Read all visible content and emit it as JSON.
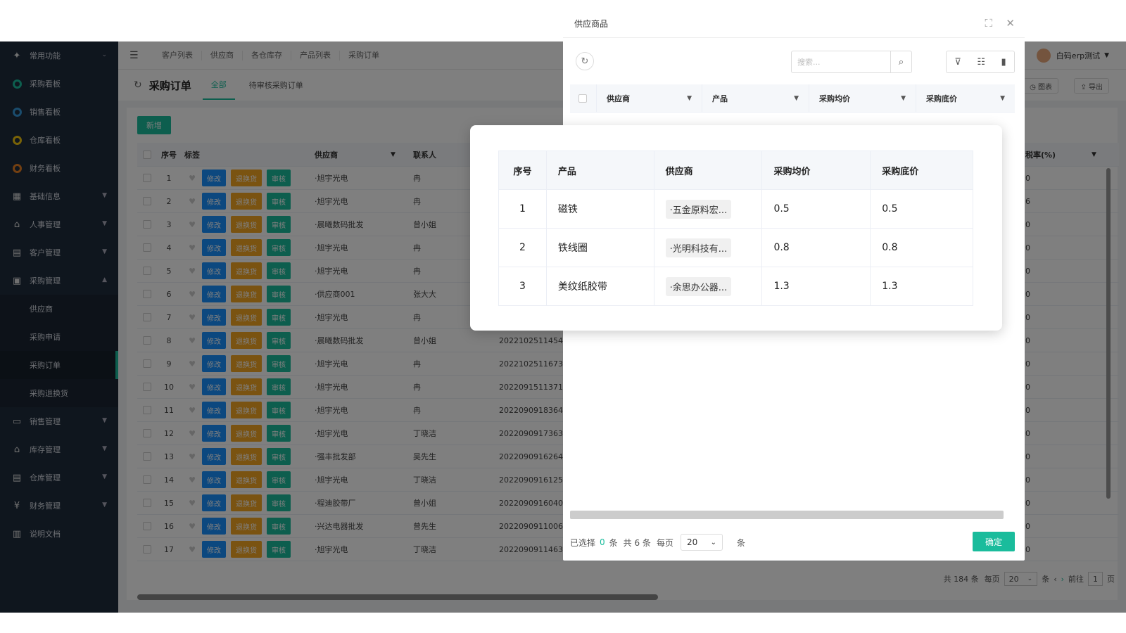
{
  "sidebar": {
    "items": [
      {
        "label": "常用功能",
        "icon": "star-icon",
        "arrow": "⌄"
      },
      {
        "label": "采购看板",
        "icon": "ring-icon"
      },
      {
        "label": "销售看板",
        "icon": "ring-icon"
      },
      {
        "label": "仓库看板",
        "icon": "ring-icon"
      },
      {
        "label": "财务看板",
        "icon": "ring-icon"
      },
      {
        "label": "基础信息",
        "icon": "chart-icon",
        "arrow": "▼"
      },
      {
        "label": "人事管理",
        "icon": "home-icon",
        "arrow": "▼"
      },
      {
        "label": "客户管理",
        "icon": "table-icon",
        "arrow": "▼"
      },
      {
        "label": "采购管理",
        "icon": "bag-icon",
        "arrow": "▲"
      }
    ],
    "sub_items": [
      "供应商",
      "采购申请",
      "采购订单",
      "采购退换货"
    ],
    "items_after": [
      {
        "label": "销售管理",
        "icon": "wallet-icon",
        "arrow": "▼"
      },
      {
        "label": "库存管理",
        "icon": "home-icon",
        "arrow": "▼"
      },
      {
        "label": "仓库管理",
        "icon": "table-icon",
        "arrow": "▼"
      },
      {
        "label": "财务管理",
        "icon": "yen-icon",
        "arrow": "▼"
      },
      {
        "label": "说明文档",
        "icon": "doc-icon"
      }
    ],
    "ring_colors": [
      "#1abc9c",
      "#3498db",
      "#f1c40f",
      "#e67e22"
    ]
  },
  "topbar": {
    "tabs": [
      "客户列表",
      "供应商",
      "各仓库存",
      "产品列表",
      "采购订单"
    ],
    "user": "白码erp测试"
  },
  "page": {
    "title": "采购订单",
    "tab_all": "全部",
    "tab_pending": "待审核采购订单",
    "btn_chart": "◷ 图表",
    "btn_export": "⇪ 导出"
  },
  "main_table": {
    "new_button": "新增",
    "headers": {
      "no": "序号",
      "tag": "标签",
      "supplier": "供应商",
      "contact": "联系人",
      "rate": "税率(%)"
    },
    "action_labels": [
      "修改",
      "退换货",
      "审核"
    ],
    "rows": [
      {
        "no": "1",
        "supplier": "·旭宇光电",
        "contact": "冉",
        "code": "",
        "rate": "0"
      },
      {
        "no": "2",
        "supplier": "·旭宇光电",
        "contact": "冉",
        "code": "",
        "rate": "6"
      },
      {
        "no": "3",
        "supplier": "·晨曦数码批发",
        "contact": "曾小姐",
        "code": "",
        "rate": "0"
      },
      {
        "no": "4",
        "supplier": "·旭宇光电",
        "contact": "冉",
        "code": "",
        "rate": "0"
      },
      {
        "no": "5",
        "supplier": "·旭宇光电",
        "contact": "冉",
        "code": "",
        "rate": "0"
      },
      {
        "no": "6",
        "supplier": "·供应商001",
        "contact": "张大大",
        "code": "",
        "rate": "0"
      },
      {
        "no": "7",
        "supplier": "·旭宇光电",
        "contact": "冉",
        "code": "",
        "rate": "0"
      },
      {
        "no": "8",
        "supplier": "·晨曦数码批发",
        "contact": "曾小姐",
        "code": "2022102511454",
        "rate": "0"
      },
      {
        "no": "9",
        "supplier": "·旭宇光电",
        "contact": "冉",
        "code": "2022102511673",
        "rate": "0"
      },
      {
        "no": "10",
        "supplier": "·旭宇光电",
        "contact": "冉",
        "code": "2022091511371",
        "rate": "0"
      },
      {
        "no": "11",
        "supplier": "·旭宇光电",
        "contact": "冉",
        "code": "2022090918364",
        "rate": "0"
      },
      {
        "no": "12",
        "supplier": "·旭宇光电",
        "contact": "丁晓洁",
        "code": "2022090917363",
        "rate": "0"
      },
      {
        "no": "13",
        "supplier": "·强丰批发部",
        "contact": "吴先生",
        "code": "2022090916264",
        "rate": "0"
      },
      {
        "no": "14",
        "supplier": "·旭宇光电",
        "contact": "丁晓洁",
        "code": "2022090916125",
        "rate": "0"
      },
      {
        "no": "15",
        "supplier": "·程迪胶带厂",
        "contact": "曾小姐",
        "code": "2022090916040",
        "rate": "0"
      },
      {
        "no": "16",
        "supplier": "·兴达电器批发",
        "contact": "曾先生",
        "code": "2022090911006",
        "rate": "0"
      },
      {
        "no": "17",
        "supplier": "·旭宇光电",
        "contact": "丁晓洁",
        "code": "2022090911463",
        "rate": "0"
      }
    ],
    "pager": {
      "total": "共 184 条",
      "per_page": "每页",
      "size": "20",
      "unit": "条",
      "goto": "前往",
      "page": "1",
      "page_unit": "页"
    }
  },
  "dialog": {
    "title": "供应商品",
    "search_placeholder": "搜索...",
    "headers": {
      "supplier": "供应商",
      "product": "产品",
      "avg": "采购均价",
      "min": "采购底价"
    },
    "footer": {
      "selected_prefix": "已选择",
      "selected_count": "0",
      "selected_suffix": "条",
      "total": "共 6 条",
      "per_page": "每页",
      "size": "20",
      "unit": "条",
      "confirm": "确定"
    }
  },
  "popup": {
    "headers": {
      "no": "序号",
      "product": "产品",
      "supplier": "供应商",
      "avg": "采购均价",
      "min": "采购底价"
    },
    "rows": [
      {
        "no": "1",
        "product": "磁铁",
        "supplier": "·五金原料宏...",
        "avg": "0.5",
        "min": "0.5"
      },
      {
        "no": "2",
        "product": "铁线圈",
        "supplier": "·光明科技有...",
        "avg": "0.8",
        "min": "0.8"
      },
      {
        "no": "3",
        "product": "美纹纸胶带",
        "supplier": "·余思办公器...",
        "avg": "1.3",
        "min": "1.3"
      }
    ]
  },
  "colors": {
    "accent": "#1abc9c",
    "sidebar": "#1f2d3d",
    "blue": "#1890ff",
    "orange": "#f5a623"
  }
}
